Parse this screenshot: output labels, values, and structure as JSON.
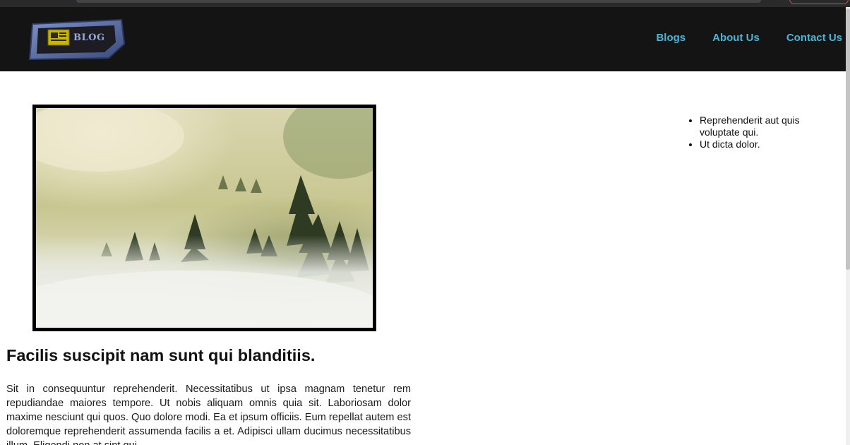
{
  "header": {
    "logo_text": "BLOG",
    "nav": [
      {
        "label": "Blogs"
      },
      {
        "label": "About Us"
      },
      {
        "label": "Contact Us"
      }
    ]
  },
  "colors": {
    "nav_background": "#141414",
    "nav_link": "#4ab6d6",
    "logo_frame": "#4a5f96"
  },
  "post": {
    "title": "Facilis suscipit nam sunt qui blanditiis.",
    "body": "Sit in consequuntur reprehenderit. Necessitatibus ut ipsa magnam tenetur rem repudiandae maiores tempore. Ut nobis aliquam omnis quia sit. Laboriosam dolor maxime nesciunt qui quos. Quo dolore modi. Ea et ipsum officiis. Eum repellat autem est doloremque reprehenderit assumenda facilis a et. Adipisci ullam ducimus necessitatibus illum. Eligendi non at sint qui"
  },
  "sidebar": {
    "items": [
      {
        "text": "Reprehenderit aut quis voluptate qui."
      },
      {
        "text": "Ut dicta dolor."
      }
    ]
  }
}
